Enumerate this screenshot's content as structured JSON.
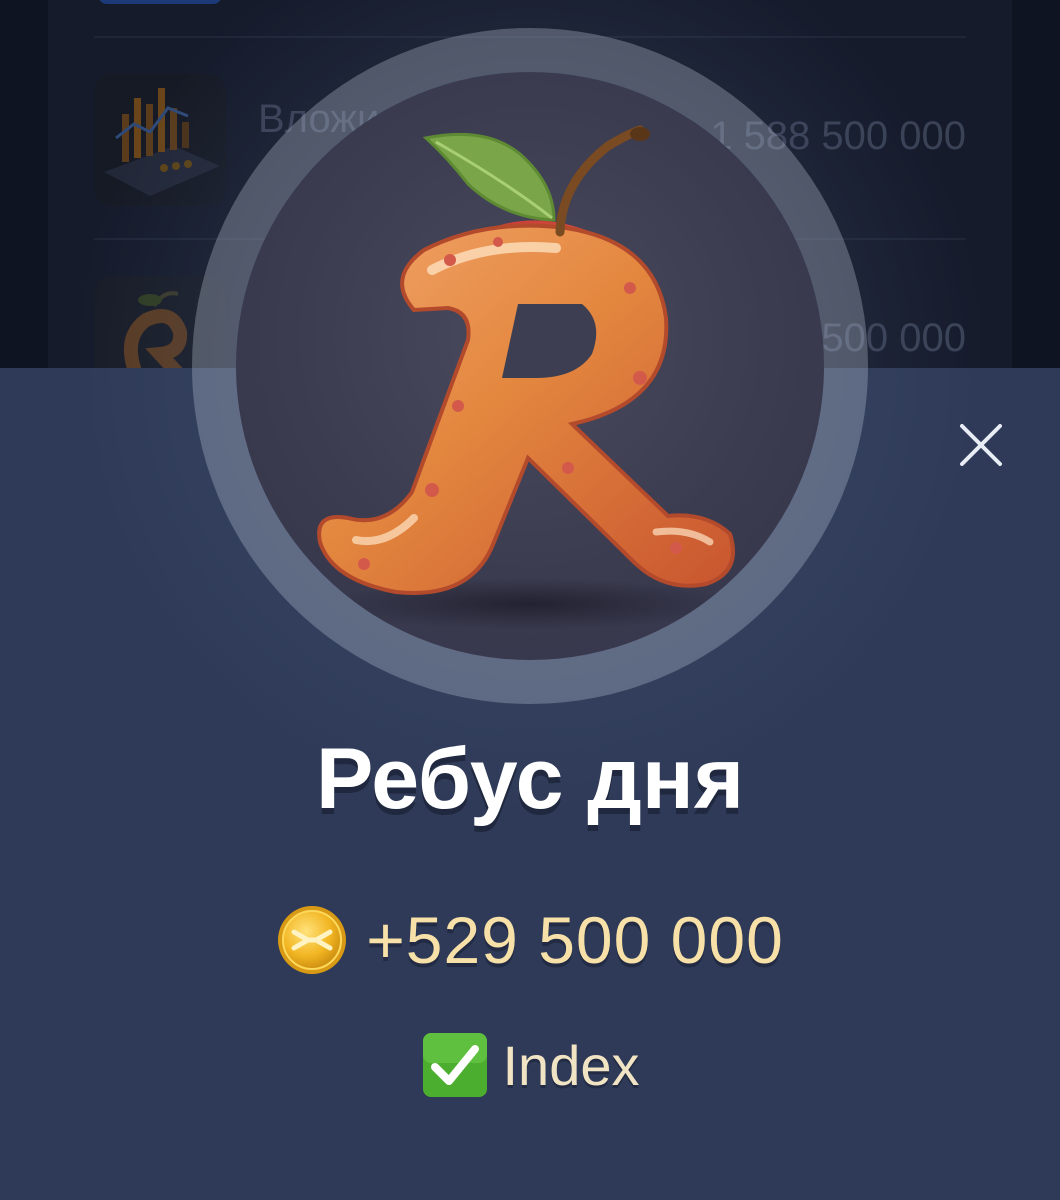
{
  "background_list": {
    "items": [
      {
        "title": "Вложи фо",
        "value": "1 588 500 000",
        "thumb_icon": "finance-chart-icon"
      },
      {
        "title": "",
        "value": "500 000",
        "thumb_icon": "apple-letter-icon"
      }
    ]
  },
  "modal": {
    "avatar_icon": "apple-letter-r-icon",
    "close_icon": "close-icon",
    "title": "Ребус дня",
    "reward": {
      "icon": "coin-icon",
      "amount": "+529 500 000"
    },
    "status": {
      "icon": "checkmark-icon",
      "label": "Index"
    }
  },
  "colors": {
    "sheet_bg": "#2e3a57",
    "page_bg": "#0e1422",
    "reward_text": "#f7e1a8",
    "check_green": "#4cae2e"
  }
}
